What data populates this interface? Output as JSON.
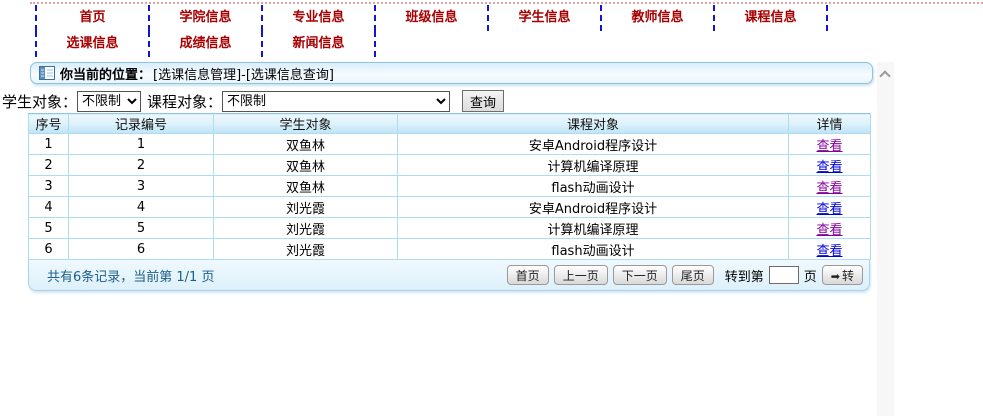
{
  "nav": {
    "row1": [
      "首页",
      "学院信息",
      "专业信息",
      "班级信息",
      "学生信息",
      "教师信息",
      "课程信息"
    ],
    "row2": [
      "选课信息",
      "成绩信息",
      "新闻信息"
    ]
  },
  "location": {
    "label": "你当前的位置：",
    "path": "[选课信息管理]-[选课信息查询]"
  },
  "filters": {
    "student_label": "学生对象：",
    "student_value": "不限制",
    "course_label": "课程对象：",
    "course_value": "不限制",
    "query_button": "查询"
  },
  "table": {
    "headers": [
      "序号",
      "记录编号",
      "学生对象",
      "课程对象",
      "详情"
    ],
    "rows": [
      {
        "index": "1",
        "record_id": "1",
        "student": "双鱼林",
        "course": "安卓Android程序设计",
        "detail": "查看",
        "visited": true
      },
      {
        "index": "2",
        "record_id": "2",
        "student": "双鱼林",
        "course": "计算机编译原理",
        "detail": "查看",
        "visited": false
      },
      {
        "index": "3",
        "record_id": "3",
        "student": "双鱼林",
        "course": "flash动画设计",
        "detail": "查看",
        "visited": true
      },
      {
        "index": "4",
        "record_id": "4",
        "student": "刘光霞",
        "course": "安卓Android程序设计",
        "detail": "查看",
        "visited": false
      },
      {
        "index": "5",
        "record_id": "5",
        "student": "刘光霞",
        "course": "计算机编译原理",
        "detail": "查看",
        "visited": true
      },
      {
        "index": "6",
        "record_id": "6",
        "student": "刘光霞",
        "course": "flash动画设计",
        "detail": "查看",
        "visited": false
      }
    ]
  },
  "pagination": {
    "summary": "共有6条记录，当前第 1/1 页",
    "first": "首页",
    "prev": "上一页",
    "next": "下一页",
    "last": "尾页",
    "goto_prefix": "转到第",
    "goto_value": "",
    "goto_suffix": "页",
    "go_arrow": "➡",
    "go_label": "转"
  },
  "colors": {
    "nav_text": "#a80000",
    "nav_divider": "#1414cc",
    "top_rule": "#dba4a4",
    "table_border": "#aedcef",
    "header_gradient_bottom": "#bfe4f6",
    "footer_bg": "#ddf0fa",
    "summary_text": "#1a5e8a",
    "link": "#0000d8",
    "link_visited": "#86009d"
  }
}
